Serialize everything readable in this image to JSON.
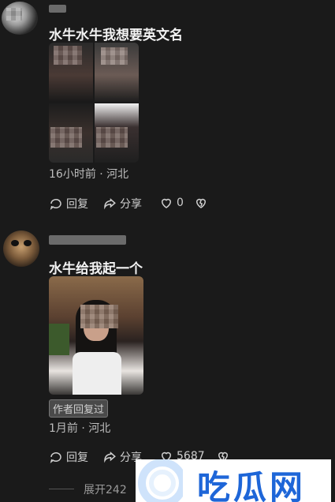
{
  "comment1": {
    "text": "水牛水牛我想要英文名",
    "meta": "16小时前 · 河北",
    "actions": {
      "reply": "回复",
      "share": "分享",
      "like_count": "0"
    }
  },
  "comment2": {
    "text": "水牛给我起一个",
    "badge": "作者回复过",
    "meta": "1月前 · 河北",
    "actions": {
      "reply": "回复",
      "share": "分享",
      "like_count": "5687"
    }
  },
  "expand": {
    "label": "展开242"
  },
  "watermark": {
    "text": "吃瓜网",
    "color": "#1e66d8"
  },
  "colors": {
    "background": "#1a1a1a",
    "text": "#eaeaea",
    "muted": "#bdbdbd"
  }
}
